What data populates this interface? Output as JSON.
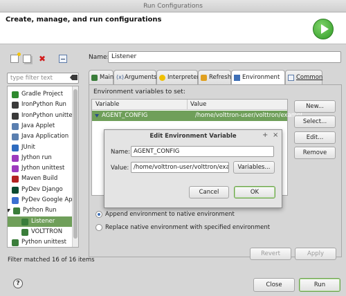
{
  "window": {
    "title": "Run Configurations"
  },
  "header": {
    "title": "Create, manage, and run configurations"
  },
  "left": {
    "filter_placeholder": "type filter text",
    "tree": [
      {
        "label": "Gradle Project",
        "icon": "gradle-icon",
        "color": "#2e8a2e"
      },
      {
        "label": "IronPython Run",
        "icon": "ironpython-icon",
        "color": "#3a3a3a"
      },
      {
        "label": "IronPython unittest",
        "icon": "ironpython-unittest-icon",
        "color": "#3a3a3a"
      },
      {
        "label": "Java Applet",
        "icon": "java-applet-icon",
        "color": "#5a7fb0"
      },
      {
        "label": "Java Application",
        "icon": "java-application-icon",
        "color": "#5a7fb0"
      },
      {
        "label": "JUnit",
        "icon": "junit-icon",
        "color": "#2e6bbf"
      },
      {
        "label": "Jython run",
        "icon": "jython-icon",
        "color": "#9c3bbd"
      },
      {
        "label": "Jython unittest",
        "icon": "jython-unittest-icon",
        "color": "#9c3bbd"
      },
      {
        "label": "Maven Build",
        "icon": "maven-icon",
        "color": "#b22222"
      },
      {
        "label": "PyDev Django",
        "icon": "django-icon",
        "color": "#0c4b33"
      },
      {
        "label": "PyDev Google App R",
        "icon": "google-app-icon",
        "color": "#3b6fd1"
      },
      {
        "label": "Python Run",
        "icon": "python-icon",
        "color": "#3a7d3a"
      },
      {
        "label": "Listener",
        "icon": "python-config-icon",
        "color": "#3a7d3a"
      },
      {
        "label": "VOLTTRON",
        "icon": "python-config-icon",
        "color": "#3a7d3a"
      },
      {
        "label": "Python unittest",
        "icon": "python-unittest-icon",
        "color": "#3a7d3a"
      }
    ],
    "status": "Filter matched 16 of 16 items"
  },
  "name": {
    "label": "Name:",
    "value": "Listener"
  },
  "tabs": [
    {
      "label": "Main",
      "icon": "python-icon"
    },
    {
      "label": "Arguments",
      "icon": "arguments-icon"
    },
    {
      "label": "Interpreter",
      "icon": "interpreter-icon"
    },
    {
      "label": "Refresh",
      "icon": "refresh-icon"
    },
    {
      "label": "Environment",
      "icon": "environment-icon"
    },
    {
      "label": "Common",
      "icon": "common-icon"
    }
  ],
  "environment": {
    "section_label": "Environment variables to set:",
    "columns": [
      "Variable",
      "Value"
    ],
    "rows": [
      {
        "variable": "AGENT_CONFIG",
        "value": "/home/volttron-user/volttron/exampl"
      }
    ],
    "buttons": {
      "new": "New...",
      "select": "Select...",
      "edit": "Edit...",
      "remove": "Remove"
    },
    "append_label": "Append environment to native environment",
    "replace_label": "Replace native environment with specified environment",
    "selected_mode": "append"
  },
  "dialog": {
    "title": "Edit Environment Variable",
    "name_label": "Name:",
    "name_value": "AGENT_CONFIG",
    "value_label": "Value:",
    "value_value": "/home/volttron-user/volttron/examp",
    "variables_button": "Variables...",
    "cancel": "Cancel",
    "ok": "OK",
    "pin_glyph": "+",
    "close_glyph": "×"
  },
  "footer": {
    "revert": "Revert",
    "apply": "Apply",
    "close": "Close",
    "run": "Run",
    "help_glyph": "?"
  },
  "colors": {
    "selection": "#6f9f5a",
    "focus_border": "#6aa34a",
    "run_green": "#2f9a24"
  }
}
